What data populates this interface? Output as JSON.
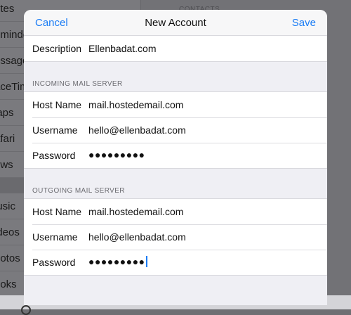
{
  "background": {
    "sidebar_items": [
      "otes",
      "eminde",
      "essage",
      "aceTim",
      "laps",
      "afari",
      "ews",
      "lusic",
      "ideos",
      "hotos",
      "ooks"
    ],
    "right_header": "CONTACTS"
  },
  "nav": {
    "cancel_label": "Cancel",
    "title": "New Account",
    "save_label": "Save"
  },
  "description_row": {
    "label": "Description",
    "value": "Ellenbadat.com"
  },
  "incoming": {
    "header": "INCOMING MAIL SERVER",
    "host_label": "Host Name",
    "host_value": "mail.hostedemail.com",
    "username_label": "Username",
    "username_value": "hello@ellenbadat.com",
    "password_label": "Password",
    "password_value": "●●●●●●●●●"
  },
  "outgoing": {
    "header": "OUTGOING MAIL SERVER",
    "host_label": "Host Name",
    "host_value": "mail.hostedemail.com",
    "username_label": "Username",
    "username_value": "hello@ellenbadat.com",
    "password_label": "Password",
    "password_value": "●●●●●●●●●"
  },
  "colors": {
    "accent": "#1a7cf5",
    "sheet_bg": "#efeff4"
  }
}
